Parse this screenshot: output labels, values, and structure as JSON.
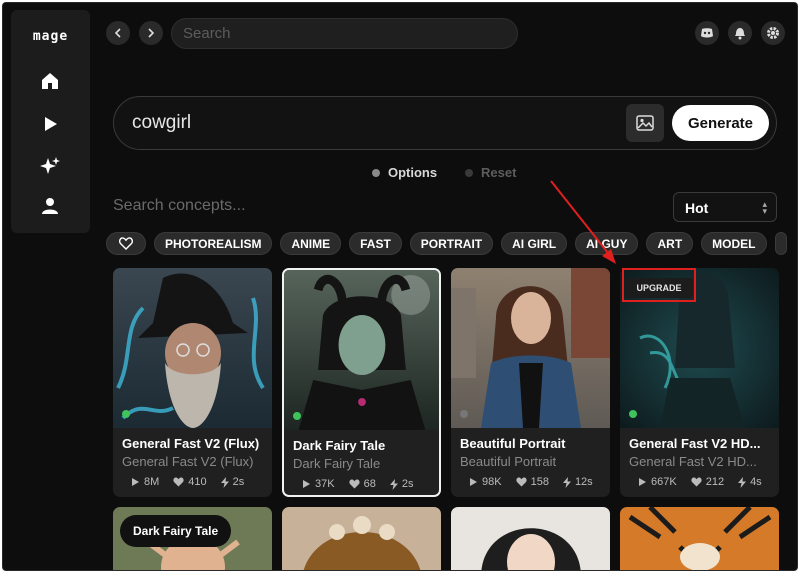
{
  "app": {
    "logo": "mage"
  },
  "sidebar": {
    "items": [
      "home-icon",
      "play-icon",
      "sparkles-icon",
      "user-icon"
    ]
  },
  "topbar": {
    "search_placeholder": "Search",
    "icons": [
      "discord-icon",
      "bell-icon",
      "gear-icon"
    ]
  },
  "prompt": {
    "value": "cowgirl",
    "generate_label": "Generate"
  },
  "options": {
    "options_label": "Options",
    "reset_label": "Reset"
  },
  "concepts": {
    "search_placeholder": "Search concepts...",
    "sort_value": "Hot"
  },
  "chips": [
    "PHOTOREALISM",
    "ANIME",
    "FAST",
    "PORTRAIT",
    "AI GIRL",
    "AI GUY",
    "ART",
    "MODEL"
  ],
  "cards": [
    {
      "title": "General Fast V2 (Flux)",
      "subtitle": "General Fast V2 (Flux)",
      "plays": "8M",
      "likes": "410",
      "time": "2s",
      "status_color": "#3ec45b"
    },
    {
      "title": "Dark Fairy Tale",
      "subtitle": "Dark Fairy Tale",
      "plays": "37K",
      "likes": "68",
      "time": "2s",
      "status_color": "#3ec45b"
    },
    {
      "title": "Beautiful Portrait",
      "subtitle": "Beautiful Portrait",
      "plays": "98K",
      "likes": "158",
      "time": "12s",
      "status_color": "#777777"
    },
    {
      "title": "General Fast V2 HD...",
      "subtitle": "General Fast V2 HD...",
      "plays": "667K",
      "likes": "212",
      "time": "4s",
      "status_color": "#3ec45b"
    }
  ],
  "upgrade_label": "UPGRADE",
  "tooltip": "Dark Fairy Tale",
  "colors": {
    "background": "#0d0d0d",
    "accent_annotation": "#e0201f",
    "status_green": "#3ec45b"
  }
}
